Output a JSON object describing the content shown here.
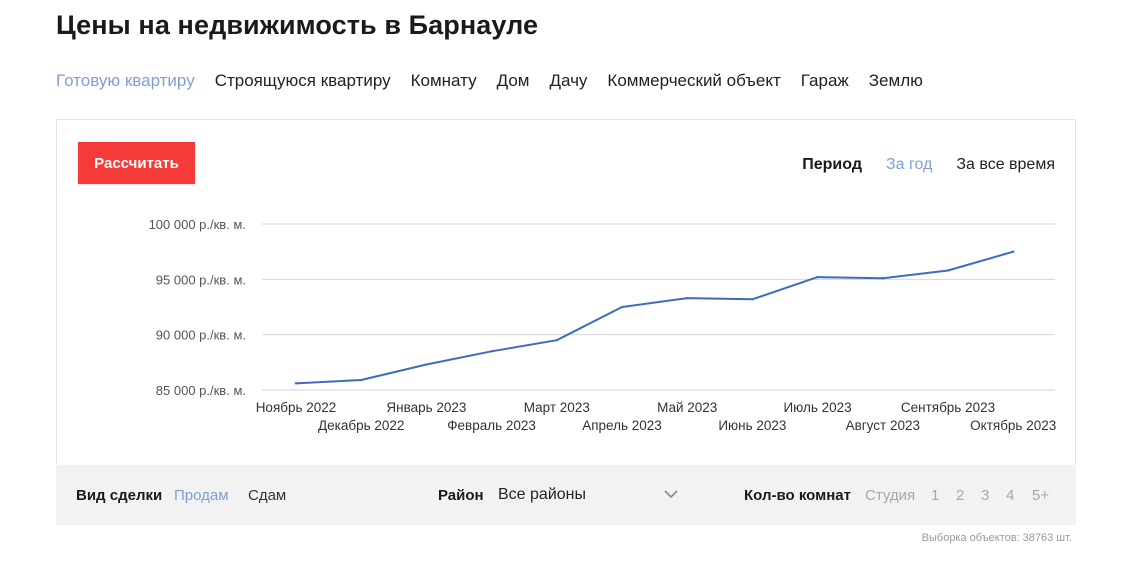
{
  "title": "Цены на недвижимость в Барнауле",
  "property_types": [
    {
      "label": "Готовую квартиру",
      "active": true
    },
    {
      "label": "Строящуюся квартиру",
      "active": false
    },
    {
      "label": "Комнату",
      "active": false
    },
    {
      "label": "Дом",
      "active": false
    },
    {
      "label": "Дачу",
      "active": false
    },
    {
      "label": "Коммерческий объект",
      "active": false
    },
    {
      "label": "Гараж",
      "active": false
    },
    {
      "label": "Землю",
      "active": false
    }
  ],
  "calc_button": "Рассчитать",
  "period": {
    "label": "Период",
    "options": [
      {
        "label": "За год",
        "active": true
      },
      {
        "label": "За все время",
        "active": false
      }
    ]
  },
  "colors": {
    "accent_link": "#7f9fd6",
    "button": "#f43b39",
    "line": "#3f6cbf",
    "grid": "#d6d6d6"
  },
  "chart_data": {
    "type": "line",
    "title": "",
    "xlabel": "",
    "ylabel": "",
    "grid": true,
    "ylim": [
      85000,
      100000
    ],
    "yticks": [
      {
        "value": 100000,
        "label": "100 000 р./кв. м."
      },
      {
        "value": 95000,
        "label": "95 000 р./кв. м."
      },
      {
        "value": 90000,
        "label": "90 000 р./кв. м."
      },
      {
        "value": 85000,
        "label": "85 000 р./кв. м."
      }
    ],
    "categories": [
      "Ноябрь 2022",
      "Декабрь 2022",
      "Январь 2023",
      "Февраль 2023",
      "Март 2023",
      "Апрель 2023",
      "Май 2023",
      "Июнь 2023",
      "Июль 2023",
      "Август 2023",
      "Сентябрь 2023",
      "Октябрь 2023"
    ],
    "series": [
      {
        "values": [
          85600,
          85900,
          87300,
          88500,
          89500,
          92500,
          93300,
          93200,
          95200,
          95100,
          95800,
          97500
        ]
      }
    ]
  },
  "filters": {
    "deal_label": "Вид сделки",
    "deal_options": [
      {
        "label": "Продам",
        "active": true
      },
      {
        "label": "Сдам",
        "active": false
      }
    ],
    "district_label": "Район",
    "district_value": "Все районы",
    "rooms_label": "Кол-во комнат",
    "room_options": [
      "Студия",
      "1",
      "2",
      "3",
      "4",
      "5+"
    ]
  },
  "sample_count": "Выборка объектов: 38763 шт."
}
